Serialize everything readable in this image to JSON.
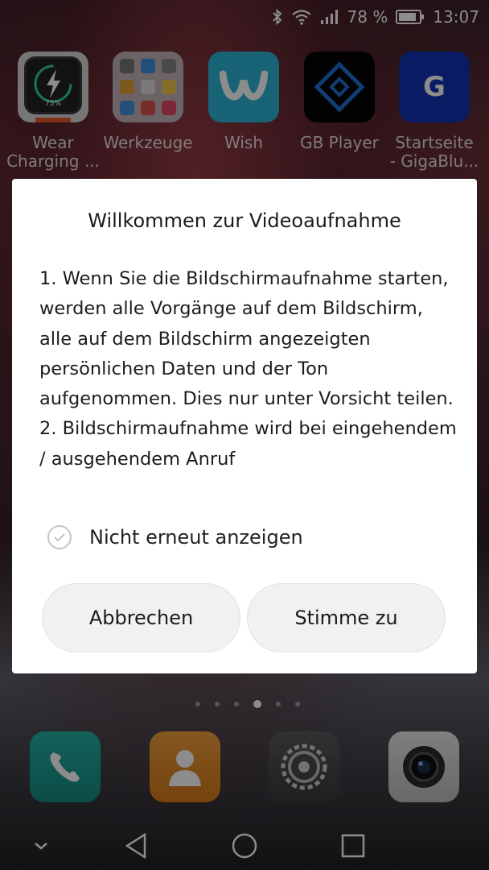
{
  "status_bar": {
    "icons": [
      "bluetooth-icon",
      "wifi-icon",
      "signal-icon",
      "battery-icon"
    ],
    "battery": "78 %",
    "time": "13:07"
  },
  "home_apps": [
    {
      "label": "Wear\nCharging ...",
      "icon": "lightning-battery-icon",
      "badge": "75%"
    },
    {
      "label": "Werkzeuge",
      "icon": "tools-folder-icon"
    },
    {
      "label": "Wish",
      "icon": "wish-logo-icon"
    },
    {
      "label": "GB Player",
      "icon": "gb-player-icon"
    },
    {
      "label": "Startseite\n- GigaBlu...",
      "icon": "gigablue-icon",
      "glyph": "G"
    }
  ],
  "dialog": {
    "title": "Willkommen zur Videoaufnahme",
    "body_1": "1. Wenn Sie die Bildschirmaufnahme starten, werden alle Vorgänge auf dem Bildschirm, alle auf dem Bildschirm angezeigten persönlichen Daten und der Ton aufgenommen. Dies nur unter Vorsicht teilen.",
    "body_2": "2. Bildschirmaufnahme wird bei eingehendem / ausgehendem Anruf",
    "checkbox_label": "Nicht erneut anzeigen",
    "checkbox_checked": false,
    "cancel_label": "Abbrechen",
    "confirm_label": "Stimme zu"
  },
  "page_indicator": {
    "count": 6,
    "active": 4
  },
  "dock": [
    "phone-icon",
    "contacts-icon",
    "settings-icon",
    "camera-icon"
  ],
  "nav_bar": [
    "collapse-chevron-icon",
    "back-icon",
    "home-icon",
    "recents-icon"
  ],
  "colors": {
    "dialog_bg": "#ffffff",
    "button_bg": "#f1f1f1",
    "wish_blue": "#2fb5d8",
    "gigablue": "#1133b5",
    "phone_teal": "#1c9a90",
    "contacts_orange": "#e08a25"
  }
}
